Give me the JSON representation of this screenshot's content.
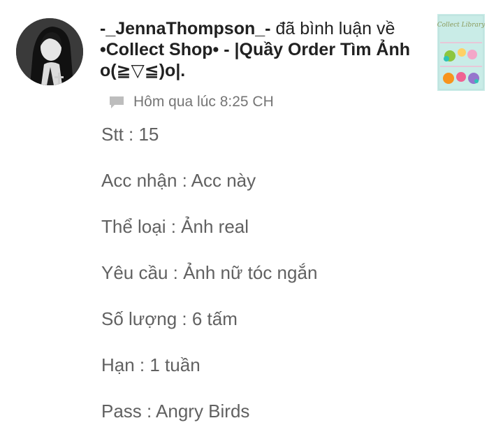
{
  "notification": {
    "username": "-_JennaThompson_-",
    "action": "đã bình luận về",
    "post_title": "•Collect Shop• - |Quầy Order Tìm Ảnh o(≧▽≦)o|.",
    "timestamp": "Hôm qua lúc 8:25 CH",
    "avatar_icon": "user-avatar-image",
    "thumbnail_icon": "post-cover-thumbnail",
    "thumbnail_caption": "Collect Library",
    "comment_icon": "comment-bubble-icon"
  },
  "comment": {
    "lines": [
      "Stt : 15",
      "Acc nhận : Acc này",
      "Thể loại : Ảnh real",
      "Yêu cầu : Ảnh nữ tóc ngắn",
      "Số lượng : 6 tấm",
      "Hạn : 1 tuần",
      "Pass : Angry Birds"
    ]
  },
  "colors": {
    "primary_text": "#212121",
    "secondary_text": "#757575",
    "comment_text": "#616161",
    "thumbnail_bg": "#c9ece7"
  }
}
